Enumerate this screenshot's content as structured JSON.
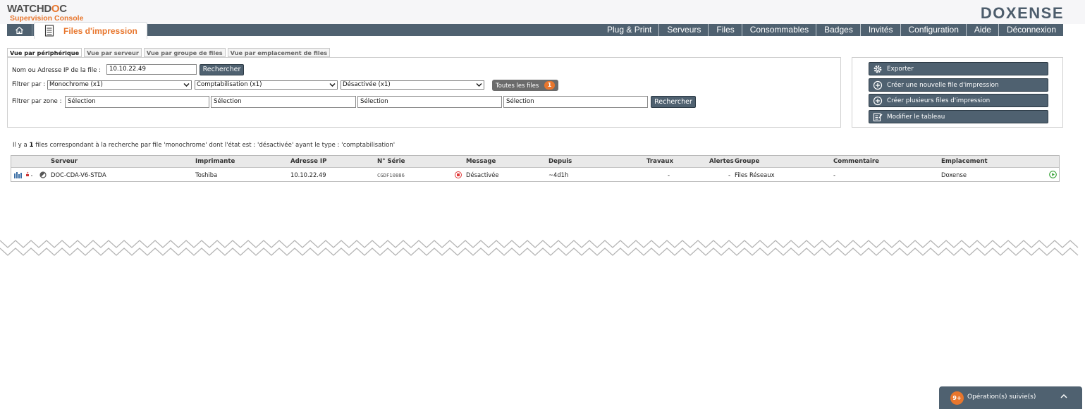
{
  "header": {
    "logo_main_prefix": "WATCHD",
    "logo_main_o": "O",
    "logo_main_suffix": "C",
    "logo_sub": "Supervision Console",
    "brand": "DOXENSE"
  },
  "nav": {
    "active_tab": "Files d'impression",
    "menu": [
      "Plug & Print",
      "Serveurs",
      "Files",
      "Consommables",
      "Badges",
      "Invités",
      "Configuration",
      "Aide",
      "Déconnexion"
    ]
  },
  "subtabs": [
    "Vue par périphérique",
    "Vue par serveur",
    "Vue par groupe de files",
    "Vue par emplacement de files"
  ],
  "filters": {
    "name_label": "Nom ou Adresse IP de la file :",
    "name_value": "10.10.22.49",
    "search_label": "Rechercher",
    "filter_label": "Filtrer par :",
    "selects": [
      "Monochrome (x1)",
      "Comptabilisation (x1)",
      "Désactivée (x1)"
    ],
    "chip_label": "Toutes les files",
    "chip_count": "1",
    "zone_label": "Filtrer par zone :",
    "zones": [
      "Sélection",
      "Sélection",
      "Sélection",
      "Sélection"
    ],
    "zone_search_label": "Rechercher"
  },
  "actions": [
    "Exporter",
    "Créer une nouvelle file d'impression",
    "Créer plusieurs files d'impression",
    "Modifier le tableau"
  ],
  "summary": {
    "prefix": "Il y a ",
    "count": "1",
    "suffix": " files correspondant à la recherche par file 'monochrome' dont l'état est : 'désactivée' ayant le type : 'comptabilisation'"
  },
  "table": {
    "headers": [
      "Serveur",
      "Imprimante",
      "Adresse IP",
      "N° Série",
      "Message",
      "Depuis",
      "Travaux",
      "Alertes",
      "Groupe",
      "Commentaire",
      "Emplacement"
    ],
    "rows": [
      {
        "serveur": "DOC-CDA-V6-STDA",
        "imprimante": "Toshiba",
        "ip": "10.10.22.49",
        "serie": "CGDF10886",
        "message": "Désactivée",
        "depuis": "~4d1h",
        "travaux": "-",
        "alertes": "-",
        "groupe": "Files Réseaux",
        "commentaire": "-",
        "emplacement": "Doxense"
      }
    ]
  },
  "operations": {
    "count": "9+",
    "label": "Opération(s) suivie(s)"
  },
  "colors": {
    "accent": "#e8762d",
    "nav": "#4f6170",
    "brand": "#4d5d6c"
  }
}
